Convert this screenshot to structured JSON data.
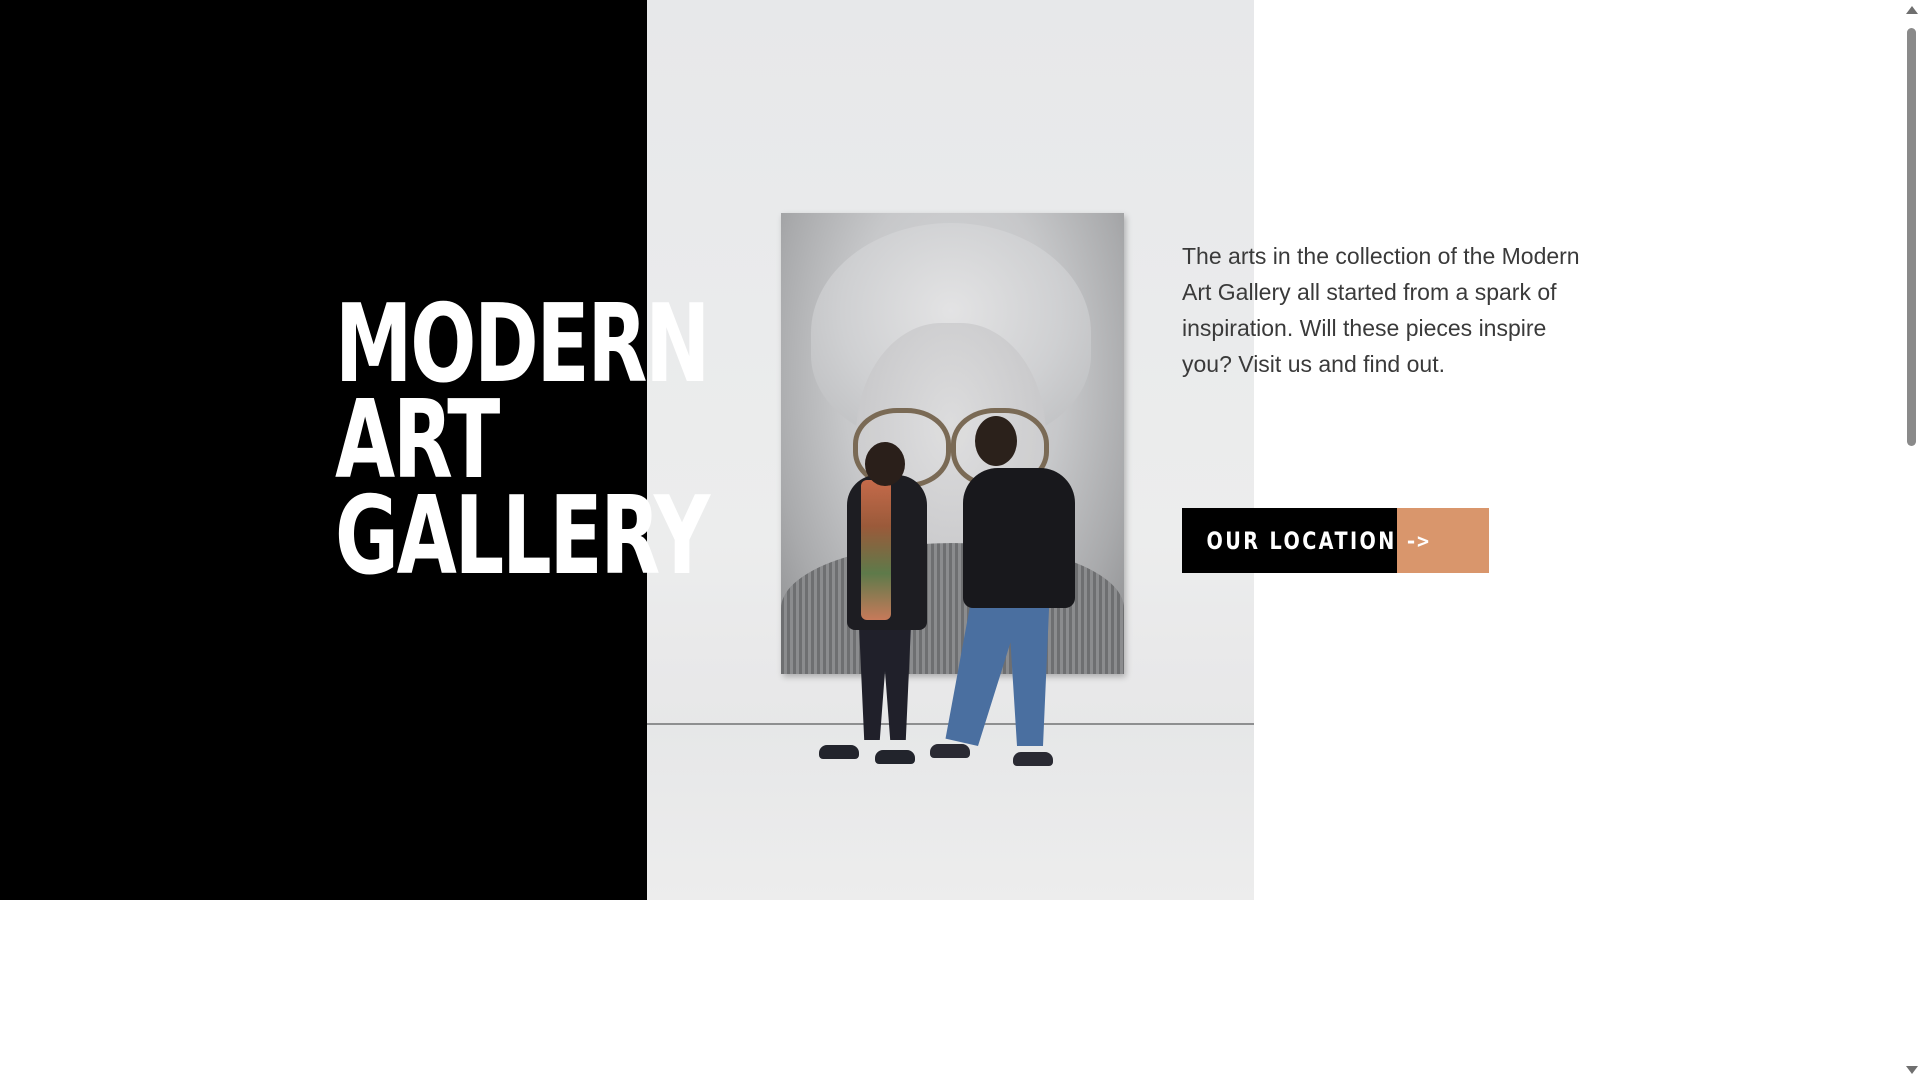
{
  "hero": {
    "title_lines": [
      "MODERN",
      "ART",
      "GALLERY"
    ],
    "description": "The arts in the collection of the Modern Art Gallery all started from a spark of inspiration. Will these pieces inspire you? Visit us and find out.",
    "button": {
      "label": "OUR LOCATION",
      "arrow": "->"
    },
    "photo_icon": "gallery-photo"
  },
  "colors": {
    "panel": "#000000",
    "title_text": "#ffffff",
    "body_text": "#3a3a3a",
    "accent": "#d9966c",
    "button_bg": "#000000"
  }
}
